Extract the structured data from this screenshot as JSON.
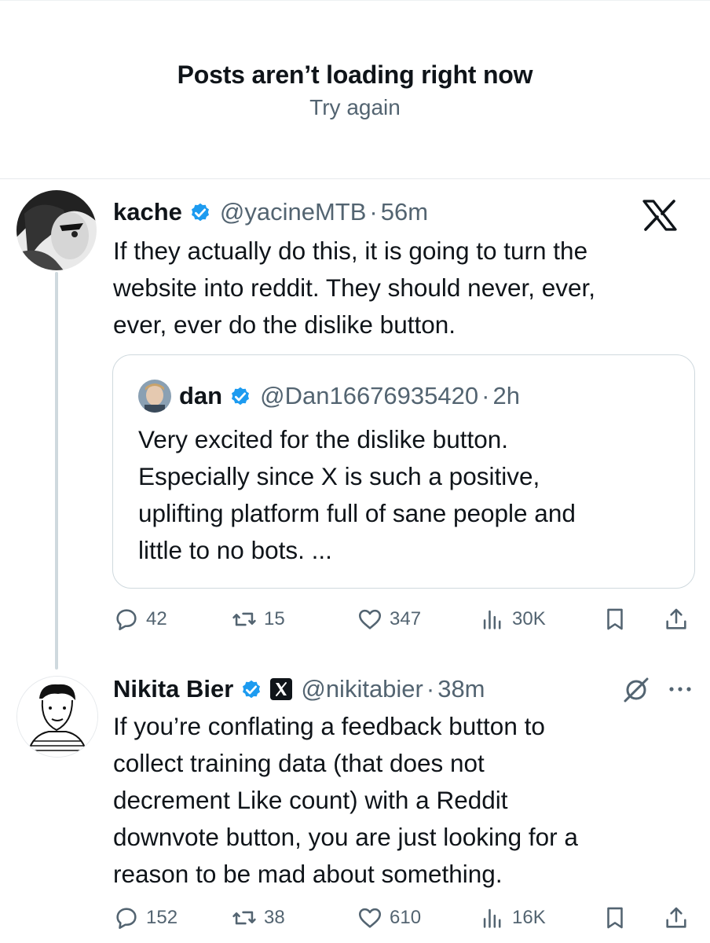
{
  "banner": {
    "title": "Posts aren’t loading right now",
    "retry": "Try again"
  },
  "posts": [
    {
      "name": "kache",
      "handle": "@yacineMTB",
      "separator": "·",
      "time": "56m",
      "text_lines": [
        "If they actually do this, it is going to turn the",
        "website into reddit. They should never, ever,",
        "ever, ever do the dislike button."
      ],
      "quote": {
        "name": "dan",
        "handle": "@Dan16676935420",
        "separator": "·",
        "time": "2h",
        "text_lines": [
          "Very excited for the dislike button.",
          "Especially since X is such a positive,",
          "uplifting platform full of sane people and",
          "little to no bots. ..."
        ]
      },
      "actions": {
        "replies": "42",
        "reposts": "15",
        "likes": "347",
        "views": "30K"
      }
    },
    {
      "name": "Nikita Bier",
      "handle": "@nikitabier",
      "separator": "·",
      "time": "38m",
      "text_lines": [
        "If you’re conflating a feedback button to",
        "collect training data (that does not",
        "decrement Like count) with a Reddit",
        "downvote button, you are just looking for a",
        "reason to be mad about something."
      ],
      "actions": {
        "replies": "152",
        "reposts": "38",
        "likes": "610",
        "views": "16K"
      }
    }
  ],
  "icons": {
    "verified": "verified-badge-icon",
    "x_logo": "x-logo-icon",
    "reply": "reply-icon",
    "repost": "repost-icon",
    "like": "like-icon",
    "views": "views-icon",
    "bookmark": "bookmark-icon",
    "share": "share-icon",
    "more": "more-icon",
    "grok": "grok-slash-icon"
  },
  "colors": {
    "verified": "#1d9bf0",
    "text": "#0f1419",
    "muted": "#536471",
    "border": "#cfd9de"
  }
}
